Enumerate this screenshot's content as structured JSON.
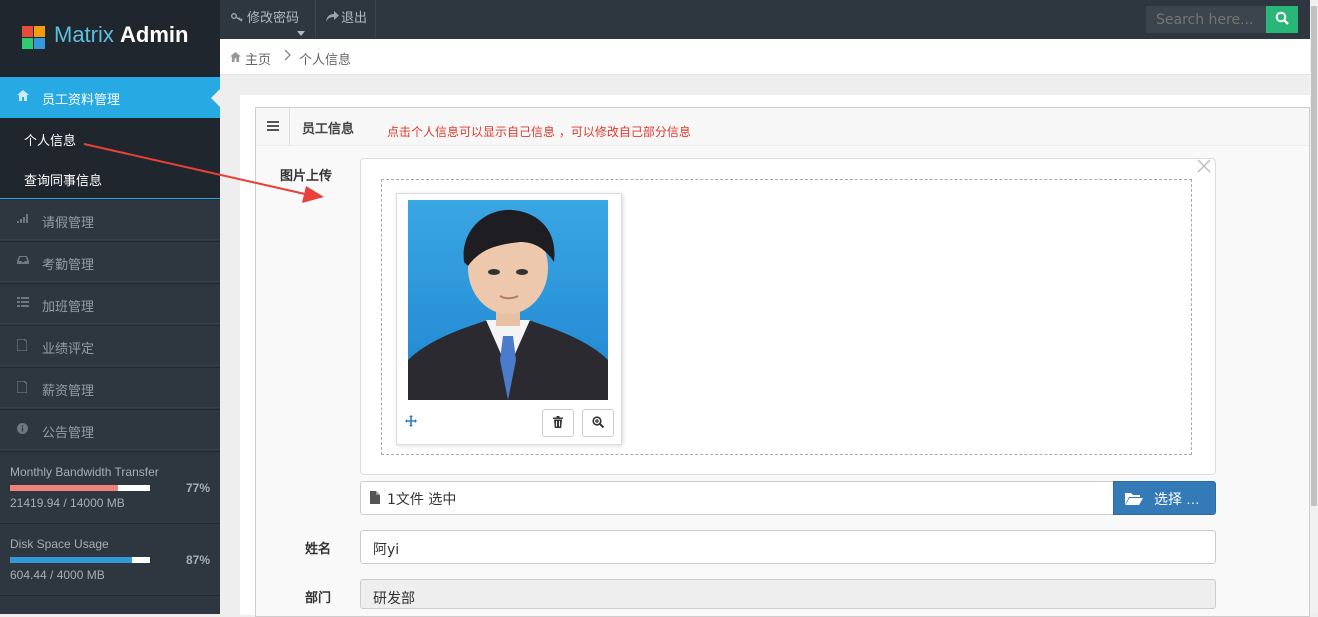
{
  "app": {
    "logo_text_part1": "Matrix",
    "logo_text_part2": "Admin"
  },
  "topbar": {
    "change_password_label": "修改密码",
    "logout_label": "退出",
    "search_placeholder": "Search here..."
  },
  "breadcrumb": {
    "home_label": "主页",
    "current_label": "个人信息"
  },
  "sidebar": {
    "active_item": "员工资料管理",
    "sub_items": [
      "个人信息",
      "查询同事信息"
    ],
    "items": [
      "请假管理",
      "考勤管理",
      "加班管理",
      "业绩评定",
      "薪资管理",
      "公告管理"
    ],
    "stats": [
      {
        "title": "Monthly Bandwidth Transfer",
        "detail": "21419.94 / 14000 MB",
        "percent_label": "77%",
        "fraction": 0.77,
        "color": "#f0817a"
      },
      {
        "title": "Disk Space Usage",
        "detail": "604.44 / 4000 MB",
        "percent_label": "87%",
        "fraction": 0.87,
        "color": "#2e9ad8"
      }
    ]
  },
  "widget": {
    "title": "员工信息",
    "hint": "点击个人信息可以显示自己信息 ，可以修改自己部分信息",
    "upload_label": "图片上传",
    "file_caption": "1文件 选中",
    "browse_label": "选择 …",
    "name_label": "姓名",
    "name_value": "阿yi",
    "dept_label": "部门",
    "dept_value": "研发部"
  },
  "colors": {
    "sidebar_bg": "#2e363f",
    "active_blue": "#27a9e3",
    "search_green": "#28b779",
    "hint_red": "#e03a2e",
    "arrow_red": "#e8403a"
  }
}
